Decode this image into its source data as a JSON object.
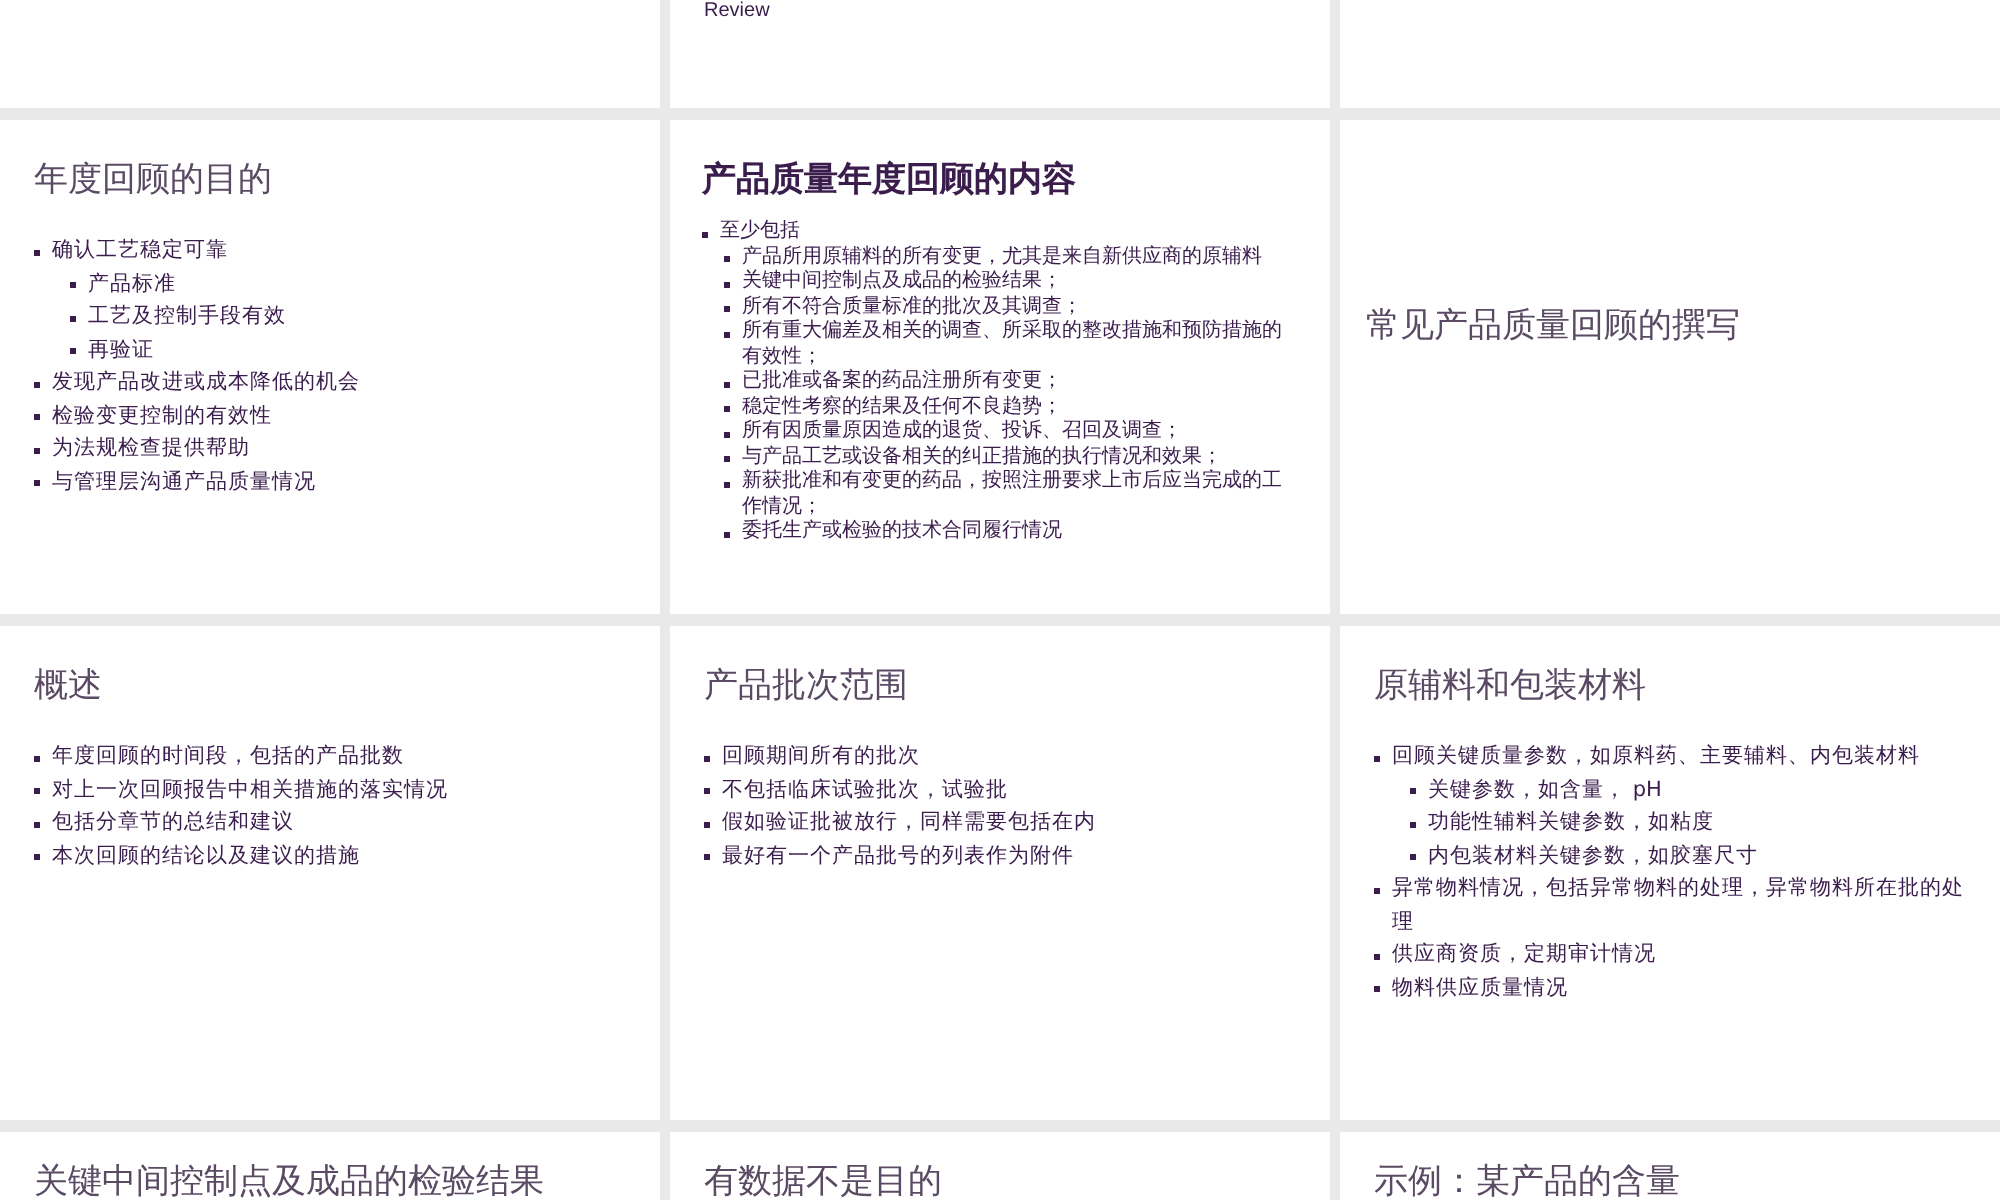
{
  "slides": [
    {
      "kind": "blank"
    },
    {
      "kind": "fragment",
      "text": "Review"
    },
    {
      "kind": "blank"
    },
    {
      "kind": "bullets",
      "title": "年度回顾的目的",
      "bullets": [
        {
          "text": "确认工艺稳定可靠",
          "children": [
            {
              "text": "产品标准"
            },
            {
              "text": "工艺及控制手段有效"
            },
            {
              "text": "再验证"
            }
          ]
        },
        {
          "text": "发现产品改进或成本降低的机会"
        },
        {
          "text": "检验变更控制的有效性"
        },
        {
          "text": "为法规检查提供帮助"
        },
        {
          "text": "与管理层沟通产品质量情况"
        }
      ]
    },
    {
      "kind": "dense",
      "title": "产品质量年度回顾的内容",
      "bullets": [
        {
          "text": "至少包括",
          "children": [
            {
              "text": "产品所用原辅料的所有变更，尤其是来自新供应商的原辅料"
            },
            {
              "text": "关键中间控制点及成品的检验结果；"
            },
            {
              "text": "所有不符合质量标准的批次及其调查；"
            },
            {
              "text": "所有重大偏差及相关的调查、所采取的整改措施和预防措施的有效性；"
            },
            {
              "text": "已批准或备案的药品注册所有变更；"
            },
            {
              "text": "稳定性考察的结果及任何不良趋势；"
            },
            {
              "text": "所有因质量原因造成的退货、投诉、召回及调查；"
            },
            {
              "text": "与产品工艺或设备相关的纠正措施的执行情况和效果；"
            },
            {
              "text": "新获批准和有变更的药品，按照注册要求上市后应当完成的工作情况；"
            },
            {
              "text": "委托生产或检验的技术合同履行情况"
            }
          ]
        }
      ]
    },
    {
      "kind": "title_only",
      "title": "常见产品质量回顾的撰写"
    },
    {
      "kind": "bullets",
      "title": "概述",
      "bullets": [
        {
          "text": "年度回顾的时间段，包括的产品批数"
        },
        {
          "text": "对上一次回顾报告中相关措施的落实情况"
        },
        {
          "text": "包括分章节的总结和建议"
        },
        {
          "text": "本次回顾的结论以及建议的措施"
        }
      ]
    },
    {
      "kind": "bullets",
      "title": "产品批次范围",
      "bullets": [
        {
          "text": "回顾期间所有的批次"
        },
        {
          "text": "不包括临床试验批次，试验批"
        },
        {
          "text": "假如验证批被放行，同样需要包括在内"
        },
        {
          "text": "最好有一个产品批号的列表作为附件"
        }
      ]
    },
    {
      "kind": "bullets",
      "title": "原辅料和包装材料",
      "bullets": [
        {
          "text": "回顾关键质量参数，如原料药、主要辅料、内包装材料",
          "children": [
            {
              "text": "关键参数，如含量， pH"
            },
            {
              "text": "功能性辅料关键参数，如粘度"
            },
            {
              "text": "内包装材料关键参数，如胶塞尺寸"
            }
          ]
        },
        {
          "text": "异常物料情况，包括异常物料的处理，异常物料所在批的处理"
        },
        {
          "text": "供应商资质，定期审计情况"
        },
        {
          "text": "物料供应质量情况"
        }
      ]
    },
    {
      "kind": "cut",
      "title": "关键中间控制点及成品的检验结果"
    },
    {
      "kind": "cut",
      "title": "有数据不是目的"
    },
    {
      "kind": "cut",
      "title": "示例：某产品的含量"
    }
  ]
}
